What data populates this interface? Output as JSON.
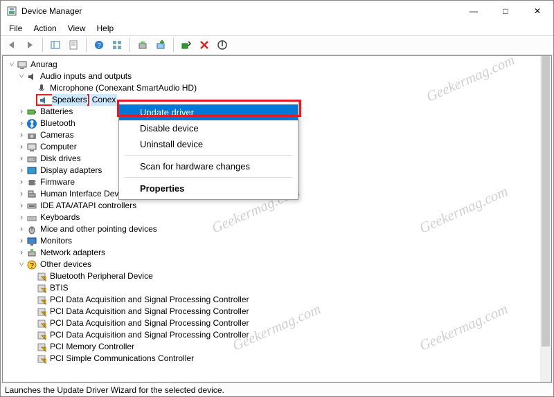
{
  "window": {
    "title": "Device Manager",
    "min": "—",
    "max": "□",
    "close": "✕"
  },
  "menu": {
    "file": "File",
    "action": "Action",
    "view": "View",
    "help": "Help"
  },
  "tree": {
    "root": "Anurag",
    "audio": {
      "label": "Audio inputs and outputs",
      "mic": "Microphone (Conexant SmartAudio HD)",
      "speakers_a": "Speakers",
      "speakers_b": "Conex"
    },
    "batteries": "Batteries",
    "bluetooth": "Bluetooth",
    "cameras": "Cameras",
    "computer": "Computer",
    "disk": "Disk drives",
    "display": "Display adapters",
    "firmware": "Firmware",
    "hid": "Human Interface Devices",
    "ide": "IDE ATA/ATAPI controllers",
    "keyboards": "Keyboards",
    "mice": "Mice and other pointing devices",
    "monitors": "Monitors",
    "network": "Network adapters",
    "other": {
      "label": "Other devices",
      "btperiph": "Bluetooth Peripheral Device",
      "btis": "BTIS",
      "pci1": "PCI Data Acquisition and Signal Processing Controller",
      "pci2": "PCI Data Acquisition and Signal Processing Controller",
      "pci3": "PCI Data Acquisition and Signal Processing Controller",
      "pci4": "PCI Data Acquisition and Signal Processing Controller",
      "pcimem": "PCI Memory Controller",
      "pcisimple": "PCI Simple Communications Controller"
    }
  },
  "ctx": {
    "update": "Update driver",
    "disable": "Disable device",
    "uninstall": "Uninstall device",
    "scan": "Scan for hardware changes",
    "properties": "Properties"
  },
  "status": "Launches the Update Driver Wizard for the selected device.",
  "watermark": "Geekermag.com"
}
